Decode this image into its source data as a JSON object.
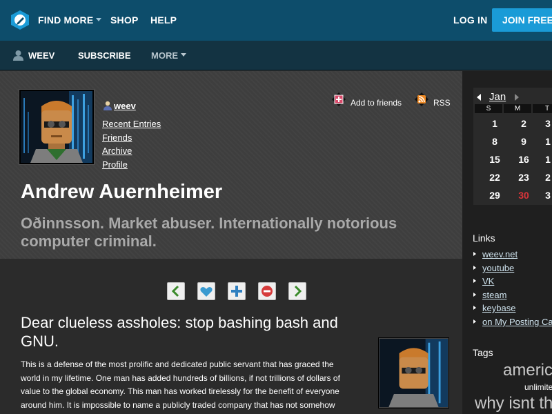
{
  "topnav": {
    "find_more": "FIND MORE",
    "shop": "SHOP",
    "help": "HELP",
    "log_in": "LOG IN",
    "join_free": "JOIN FREE"
  },
  "subnav": {
    "user": "WEEV",
    "subscribe": "SUBSCRIBE",
    "more": "MORE"
  },
  "profile": {
    "username": "weev",
    "links": [
      "Recent Entries",
      "Friends",
      "Archive",
      "Profile"
    ],
    "add_to_friends": "Add to friends",
    "rss": "RSS",
    "title": "Andrew Auernheimer",
    "subtitle": "Oðinnsson. Market abuser. Internationally notorious computer criminal."
  },
  "post": {
    "title": "Dear clueless assholes: stop bashing bash and GNU.",
    "body_lines": [
      "This is a defense of the most prolific and dedicated public servant that has graced the",
      "world in my lifetime. One man has added hundreds of billions, if not trillions of dollars of",
      "value to the global economy. This man has worked tirelessly for the benefit of everyone",
      "around him. It is impossible to name a publicly traded company that has not somehow"
    ]
  },
  "calendar": {
    "month": "Jan",
    "dow": [
      "S",
      "M",
      "T"
    ],
    "rows": [
      [
        "1",
        "2",
        "3"
      ],
      [
        "8",
        "9",
        "1"
      ],
      [
        "15",
        "16",
        "1"
      ],
      [
        "22",
        "23",
        "2"
      ],
      [
        "29",
        "30",
        "3"
      ]
    ],
    "today": "30"
  },
  "links": {
    "heading": "Links",
    "items": [
      "weev.net",
      "youtube",
      "VK",
      "steam",
      "keybase",
      "on My Posting Ca"
    ]
  },
  "tags": {
    "heading": "Tags",
    "items": [
      "americ",
      "unlimite",
      "why isnt th"
    ]
  },
  "colors": {
    "topbar": "#0d4d6b",
    "subbar": "#133342",
    "accent": "#1a9bd7",
    "today": "#d9343a"
  }
}
